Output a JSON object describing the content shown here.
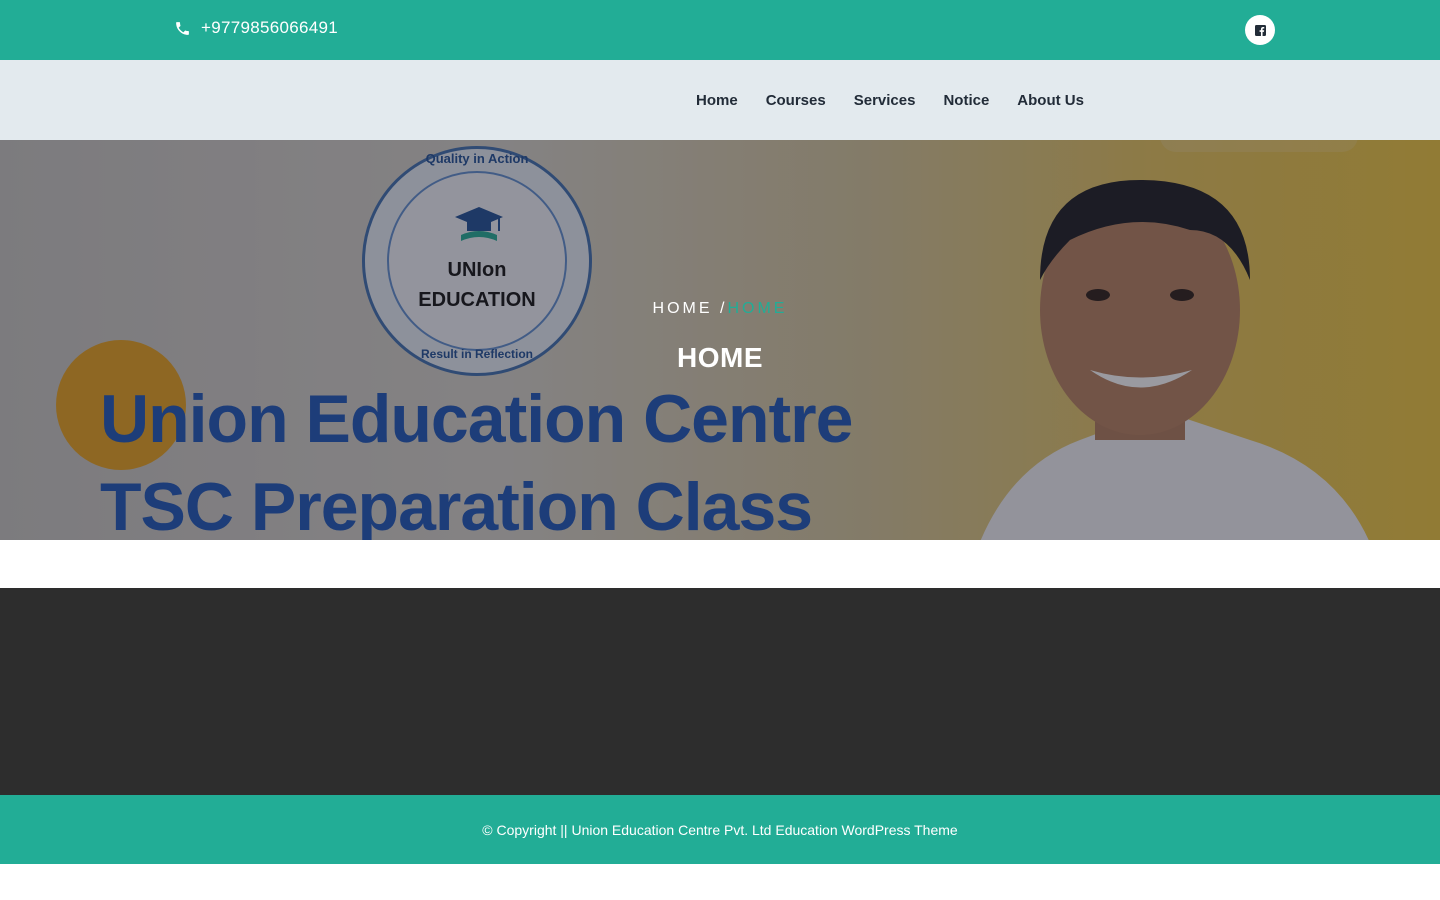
{
  "topbar": {
    "phone": "+9779856066491",
    "social": [
      "facebook"
    ]
  },
  "nav": {
    "items": [
      "Home",
      "Courses",
      "Services",
      "Notice",
      "About Us"
    ]
  },
  "hero": {
    "breadcrumb_home": "HOME",
    "breadcrumb_sep": "/",
    "breadcrumb_current": "HOME",
    "title": "HOME",
    "banner": {
      "badge_top": "Quality in Action",
      "badge_name_1": "UNIon",
      "badge_name_2": "EDUCATION",
      "badge_bottom": "Result in Reflection",
      "line1": "Union Education Centre",
      "line2": "TSC Preparation Class"
    }
  },
  "footer": {
    "copyright": "© Copyright || Union Education Centre Pvt. Ltd Education WordPress Theme"
  },
  "colors": {
    "accent": "#22ad96",
    "nav_bg": "#e3eaee",
    "dark_section": "#2d2d2d"
  }
}
